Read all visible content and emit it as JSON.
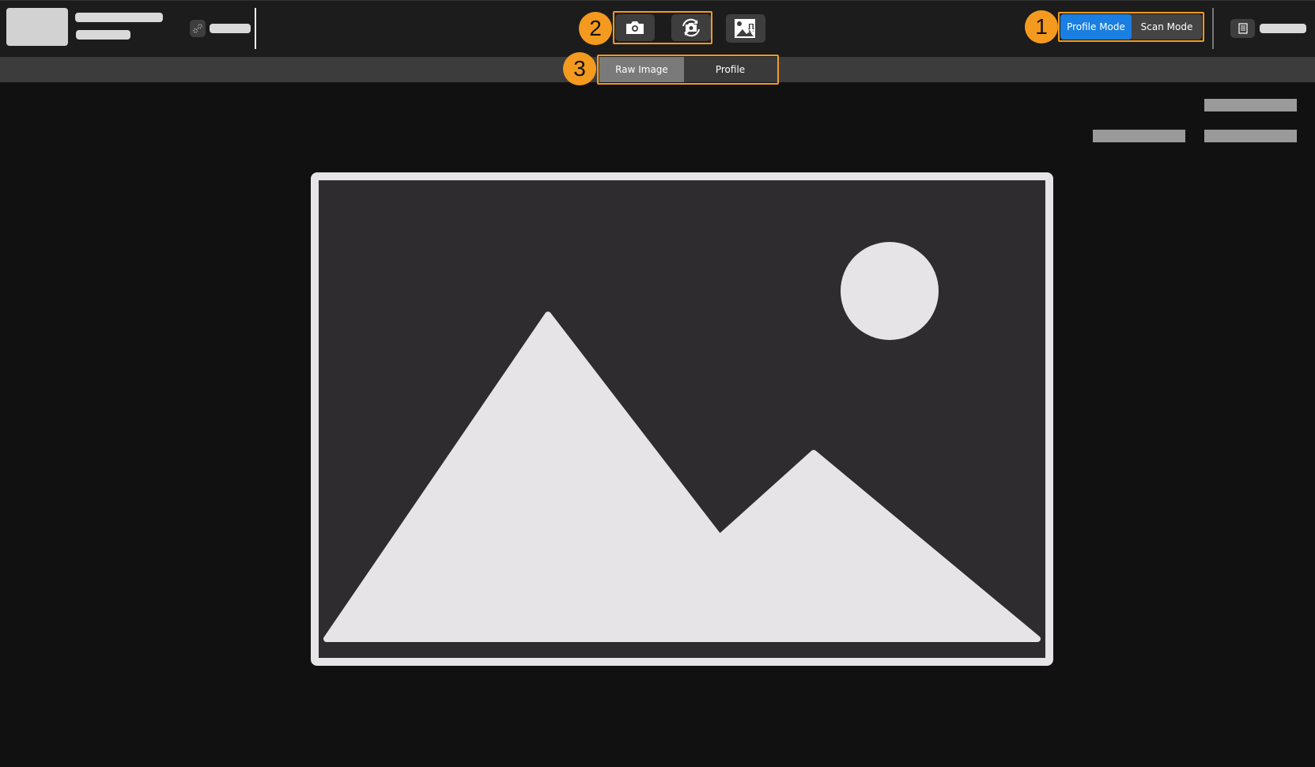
{
  "toolbar": {
    "capture_icon": "camera-icon",
    "continuous_capture_icon": "camera-rotate-icon",
    "save_image_icon": "image-download-icon",
    "link_icon": "unlink-icon",
    "log_icon": "document-icon"
  },
  "mode_switch": {
    "items": [
      "Profile Mode",
      "Scan Mode"
    ],
    "selected": "Profile Mode"
  },
  "view_tabs": {
    "items": [
      "Raw Image",
      "Profile"
    ],
    "selected": "Raw Image"
  },
  "callouts": [
    "1",
    "2",
    "3"
  ],
  "colors": {
    "accent": "#1a7fe0",
    "callout": "#f39a1f"
  }
}
